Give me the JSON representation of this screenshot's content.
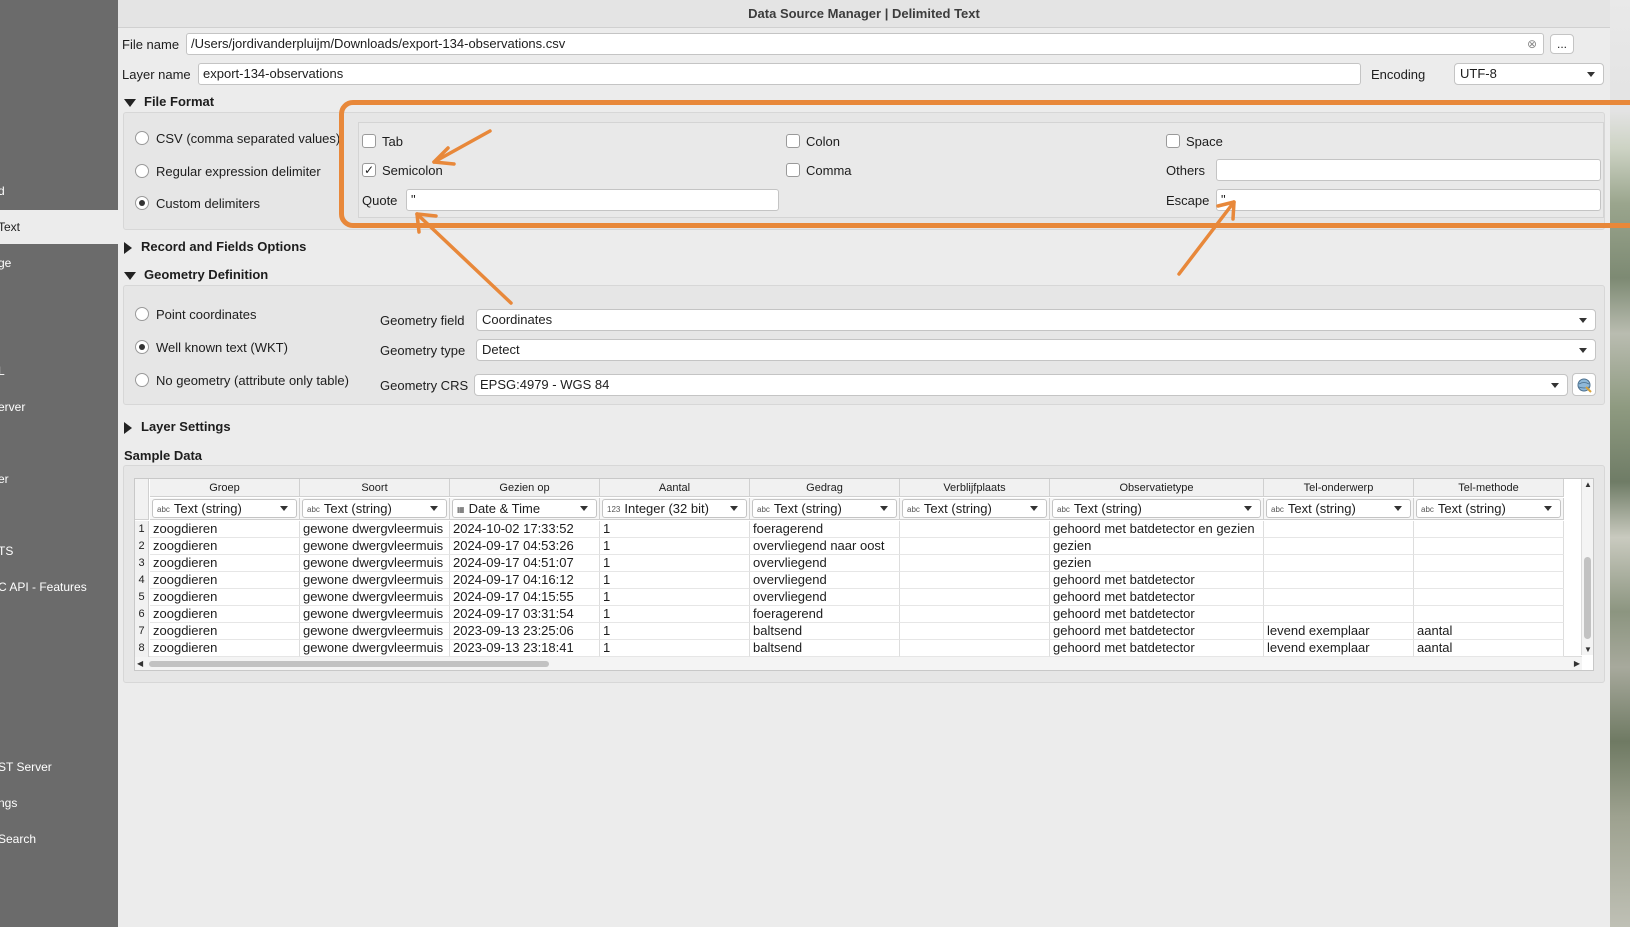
{
  "window": {
    "title": "Data Source Manager | Delimited Text"
  },
  "sidebar": {
    "items": [
      {
        "label": "d",
        "selected": false
      },
      {
        "label": "Text",
        "selected": true
      },
      {
        "label": "ge",
        "selected": false
      },
      {
        "label": "L",
        "selected": false
      },
      {
        "label": "erver",
        "selected": false
      },
      {
        "label": "er",
        "selected": false
      },
      {
        "label": "TS",
        "selected": false
      },
      {
        "label": "C API - Features",
        "selected": false
      },
      {
        "label": "ST Server",
        "selected": false
      },
      {
        "label": "ngs",
        "selected": false
      },
      {
        "label": "Search",
        "selected": false
      }
    ]
  },
  "file": {
    "label": "File name",
    "value": "/Users/jordivanderpluijm/Downloads/export-134-observations.csv",
    "browse_label": "..."
  },
  "layer": {
    "label": "Layer name",
    "value": "export-134-observations",
    "encoding_label": "Encoding",
    "encoding_value": "UTF-8"
  },
  "file_format": {
    "title": "File Format",
    "options": [
      {
        "label": "CSV (comma separated values)",
        "selected": false
      },
      {
        "label": "Regular expression delimiter",
        "selected": false
      },
      {
        "label": "Custom delimiters",
        "selected": true
      }
    ],
    "delimiters": {
      "tab": {
        "label": "Tab",
        "checked": false
      },
      "colon": {
        "label": "Colon",
        "checked": false
      },
      "space": {
        "label": "Space",
        "checked": false
      },
      "semicolon": {
        "label": "Semicolon",
        "checked": true
      },
      "comma": {
        "label": "Comma",
        "checked": false
      },
      "others_label": "Others",
      "others_value": "",
      "quote_label": "Quote",
      "quote_value": "\"",
      "escape_label": "Escape",
      "escape_value": "\""
    },
    "check_mark": "✓"
  },
  "record_options": {
    "title": "Record and Fields Options"
  },
  "geometry": {
    "title": "Geometry Definition",
    "options": [
      {
        "label": "Point coordinates",
        "selected": false
      },
      {
        "label": "Well known text (WKT)",
        "selected": true
      },
      {
        "label": "No geometry (attribute only table)",
        "selected": false
      }
    ],
    "field_label": "Geometry field",
    "field_value": "Coordinates",
    "type_label": "Geometry type",
    "type_value": "Detect",
    "crs_label": "Geometry CRS",
    "crs_value": "EPSG:4979 - WGS 84"
  },
  "layer_settings": {
    "title": "Layer Settings"
  },
  "sample": {
    "title": "Sample Data",
    "columns": [
      "Groep",
      "Soort",
      "Gezien op",
      "Aantal",
      "Gedrag",
      "Verblijfplaats",
      "Observatietype",
      "Tel-onderwerp",
      "Tel-methode"
    ],
    "types": [
      {
        "icon": "abc",
        "label": "Text (string)"
      },
      {
        "icon": "abc",
        "label": "Text (string)"
      },
      {
        "icon": "cal",
        "label": "Date & Time"
      },
      {
        "icon": "123",
        "label": "Integer (32 bit)"
      },
      {
        "icon": "abc",
        "label": "Text (string)"
      },
      {
        "icon": "abc",
        "label": "Text (string)"
      },
      {
        "icon": "abc",
        "label": "Text (string)"
      },
      {
        "icon": "abc",
        "label": "Text (string)"
      },
      {
        "icon": "abc",
        "label": "Text (string)"
      }
    ],
    "rows": [
      {
        "n": "1",
        "cells": [
          "zoogdieren",
          "gewone dwergvleermuis",
          "2024-10-02 17:33:52",
          "1",
          "foeragerend",
          "",
          "gehoord met batdetector en gezien",
          "",
          ""
        ]
      },
      {
        "n": "2",
        "cells": [
          "zoogdieren",
          "gewone dwergvleermuis",
          "2024-09-17 04:53:26",
          "1",
          "overvliegend naar oost",
          "",
          "gezien",
          "",
          ""
        ]
      },
      {
        "n": "3",
        "cells": [
          "zoogdieren",
          "gewone dwergvleermuis",
          "2024-09-17 04:51:07",
          "1",
          "overvliegend",
          "",
          "gezien",
          "",
          ""
        ]
      },
      {
        "n": "4",
        "cells": [
          "zoogdieren",
          "gewone dwergvleermuis",
          "2024-09-17 04:16:12",
          "1",
          "overvliegend",
          "",
          "gehoord met batdetector",
          "",
          ""
        ]
      },
      {
        "n": "5",
        "cells": [
          "zoogdieren",
          "gewone dwergvleermuis",
          "2024-09-17 04:15:55",
          "1",
          "overvliegend",
          "",
          "gehoord met batdetector",
          "",
          ""
        ]
      },
      {
        "n": "6",
        "cells": [
          "zoogdieren",
          "gewone dwergvleermuis",
          "2024-09-17 03:31:54",
          "1",
          "foeragerend",
          "",
          "gehoord met batdetector",
          "",
          ""
        ]
      },
      {
        "n": "7",
        "cells": [
          "zoogdieren",
          "gewone dwergvleermuis",
          "2023-09-13 23:25:06",
          "1",
          "baltsend",
          "",
          "gehoord met batdetector",
          "levend exemplaar",
          "aantal"
        ]
      },
      {
        "n": "8",
        "cells": [
          "zoogdieren",
          "gewone dwergvleermuis",
          "2023-09-13 23:18:41",
          "1",
          "baltsend",
          "",
          "gehoord met batdetector",
          "levend exemplaar",
          "aantal"
        ]
      }
    ]
  },
  "colors": {
    "highlight": "#e8883a",
    "sidebar": "#6b6b6b",
    "dialog": "#ececec"
  }
}
